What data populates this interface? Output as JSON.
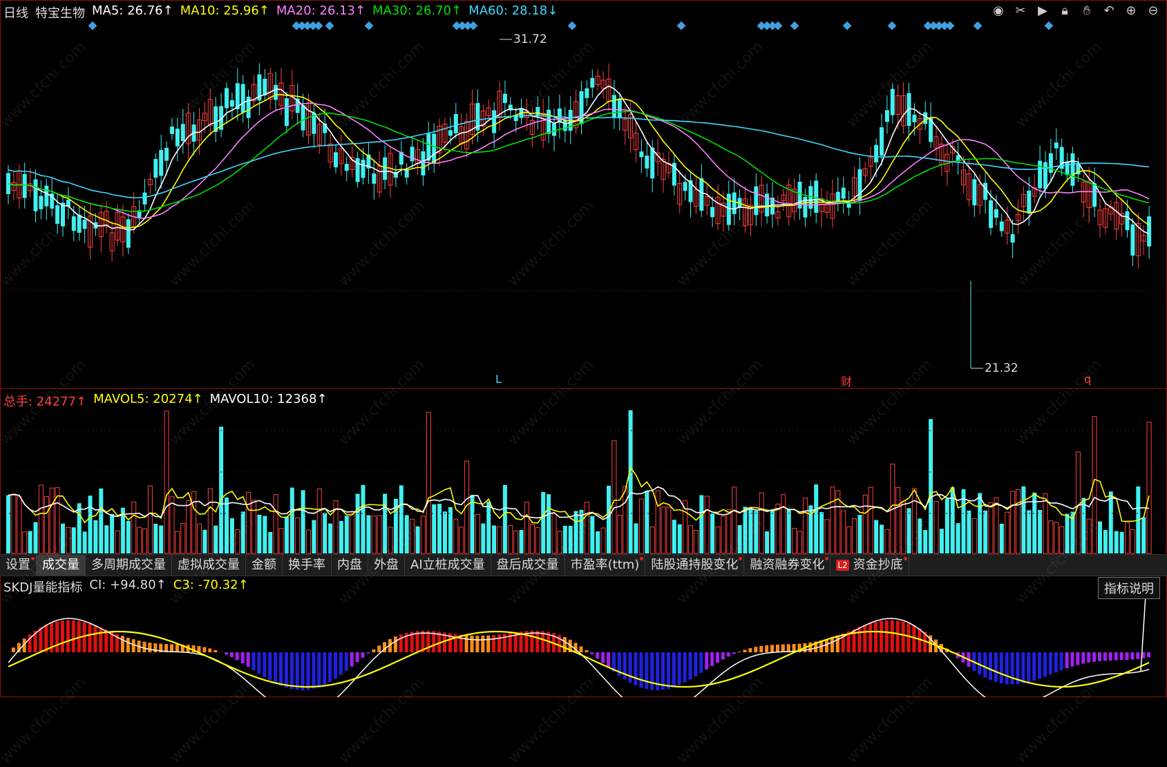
{
  "header": {
    "period": "日线",
    "stock_name": "特宝生物",
    "ma": [
      {
        "label": "MA5: 26.76↑",
        "color": "#ffffff"
      },
      {
        "label": "MA10: 25.96↑",
        "color": "#ffff00"
      },
      {
        "label": "MA20: 26.13↑",
        "color": "#ff80ff"
      },
      {
        "label": "MA30: 26.70↑",
        "color": "#00e000"
      },
      {
        "label": "MA60: 28.18↓",
        "color": "#40d8ff"
      }
    ]
  },
  "toolbar": {
    "icons": [
      "eye-icon",
      "scissors-icon",
      "play-icon",
      "lock-icon",
      "hand-icon",
      "undo-icon",
      "zoom-in-icon",
      "zoom-out-icon"
    ]
  },
  "price_chart": {
    "high_label": "31.72",
    "low_label": "21.32",
    "markers": [
      {
        "text": "L",
        "color": "#40d8ff"
      },
      {
        "text": "财",
        "color": "#ff4040"
      },
      {
        "text": "q",
        "color": "#ff4040"
      }
    ],
    "colors": {
      "up": "#ff4040",
      "down": "#40f0f0",
      "ma5": "#ffffff",
      "ma10": "#ffff00",
      "ma20": "#ff80ff",
      "ma30": "#00e000",
      "ma60": "#40d8ff",
      "diamond": "#40a0e0"
    }
  },
  "volume": {
    "total_label": "总手: 24277↑",
    "mavol5_label": "MAVOL5: 20274↑",
    "mavol10_label": "MAVOL10: 12368↑",
    "colors": {
      "total": "#ff4040",
      "mavol5": "#ffff00",
      "mavol10": "#ffffff"
    }
  },
  "tabs": [
    {
      "label": "设置",
      "dot": true,
      "active": false
    },
    {
      "label": "成交量",
      "dot": false,
      "active": true
    },
    {
      "label": "多周期成交量",
      "dot": false,
      "active": false
    },
    {
      "label": "虚拟成交量",
      "dot": false,
      "active": false
    },
    {
      "label": "金额",
      "dot": false,
      "active": false
    },
    {
      "label": "换手率",
      "dot": false,
      "active": false
    },
    {
      "label": "内盘",
      "dot": false,
      "active": false
    },
    {
      "label": "外盘",
      "dot": false,
      "active": false
    },
    {
      "label": "AI立桩成交量",
      "dot": false,
      "active": false
    },
    {
      "label": "盘后成交量",
      "dot": false,
      "active": false
    },
    {
      "label": "市盈率(ttm)",
      "dot": true,
      "active": false
    },
    {
      "label": "陆股通持股变化",
      "dot": true,
      "active": false
    },
    {
      "label": "融资融券变化",
      "dot": true,
      "active": false
    },
    {
      "label": "资金抄底",
      "dot": true,
      "active": false,
      "badge": "L2"
    }
  ],
  "indicator": {
    "name": "SKDJ量能指标",
    "ci_label": "CI: +94.80↑",
    "c3_label": "C3: -70.32↑",
    "explain_button": "指标说明"
  },
  "watermark": "www.cfchi.com"
}
